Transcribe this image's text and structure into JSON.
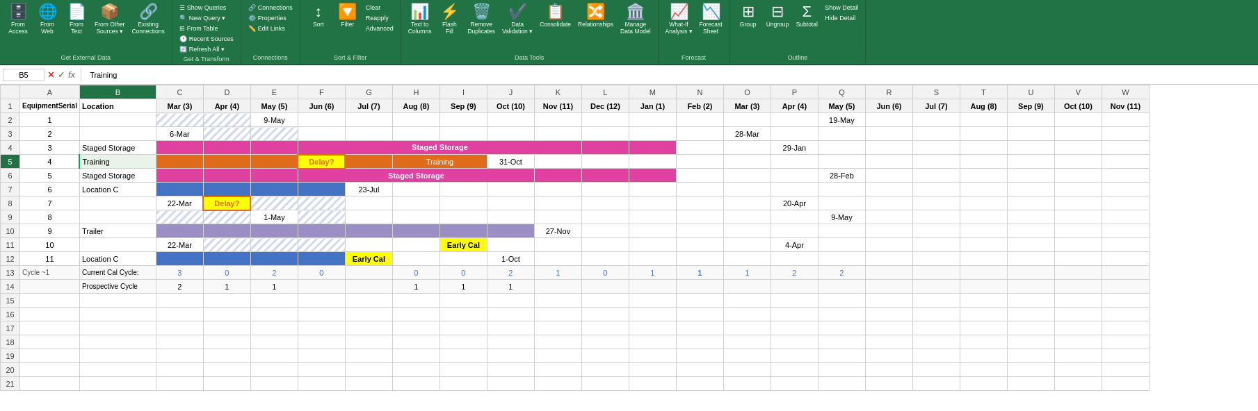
{
  "ribbon": {
    "sections": [
      {
        "name": "Get External Data",
        "label": "Get External Data",
        "buttons": [
          {
            "id": "from-access",
            "icon": "🗄️",
            "label": "From\nAccess"
          },
          {
            "id": "from-web",
            "icon": "🌐",
            "label": "From\nWeb"
          },
          {
            "id": "from-text",
            "icon": "📄",
            "label": "From\nText"
          },
          {
            "id": "from-other",
            "icon": "📦",
            "label": "From Other\nSources"
          },
          {
            "id": "existing-connections",
            "icon": "🔗",
            "label": "Existing\nConnections"
          }
        ]
      },
      {
        "name": "Get & Transform",
        "label": "Get & Transform",
        "buttons_stacked": [
          {
            "id": "show-queries",
            "label": "Show Queries"
          },
          {
            "id": "from-table",
            "label": "From Table"
          },
          {
            "id": "new-query",
            "label": "New Query ▾"
          },
          {
            "id": "recent-sources",
            "label": "Recent Sources"
          },
          {
            "id": "refresh-all",
            "label": "Refresh All ▾"
          }
        ]
      },
      {
        "name": "Connections",
        "label": "Connections",
        "buttons_stacked": [
          {
            "id": "connections",
            "label": "Connections"
          },
          {
            "id": "properties",
            "label": "Properties"
          },
          {
            "id": "edit-links",
            "label": "Edit Links"
          }
        ]
      },
      {
        "name": "Sort & Filter",
        "label": "Sort & Filter",
        "buttons": [
          {
            "id": "sort",
            "icon": "↕️",
            "label": "Sort"
          },
          {
            "id": "filter",
            "icon": "🔽",
            "label": "Filter"
          },
          {
            "id": "clear",
            "label": "Clear"
          },
          {
            "id": "reapply",
            "label": "Reapply"
          },
          {
            "id": "advanced",
            "label": "Advanced"
          }
        ]
      },
      {
        "name": "Data Tools",
        "label": "Data Tools",
        "buttons": [
          {
            "id": "text-to-columns",
            "label": "Text to\nColumns"
          },
          {
            "id": "flash-fill",
            "label": "Flash\nFill"
          },
          {
            "id": "remove-duplicates",
            "label": "Remove\nDuplicates"
          },
          {
            "id": "data-validation",
            "label": "Data\nValidation ▾"
          },
          {
            "id": "consolidate",
            "label": "Consolidate"
          },
          {
            "id": "relationships",
            "label": "Relationships"
          },
          {
            "id": "manage-data-model",
            "label": "Manage\nData Model"
          }
        ]
      },
      {
        "name": "Forecast",
        "label": "Forecast",
        "buttons": [
          {
            "id": "what-if",
            "label": "What-If\nAnalysis ▾"
          },
          {
            "id": "forecast-sheet",
            "label": "Forecast\nSheet"
          }
        ]
      },
      {
        "name": "Outline",
        "label": "Outline",
        "buttons": [
          {
            "id": "group",
            "label": "Group"
          },
          {
            "id": "ungroup",
            "label": "Ungroup"
          },
          {
            "id": "subtotal",
            "label": "Subtotal"
          },
          {
            "id": "show-detail",
            "label": "Show Detail"
          },
          {
            "id": "hide-detail",
            "label": "Hide Detail"
          }
        ]
      }
    ],
    "formula_bar": {
      "name_box": "B5",
      "formula_value": "Training"
    }
  },
  "columns": [
    "A",
    "B",
    "C",
    "D",
    "E",
    "F",
    "G",
    "H",
    "I",
    "J",
    "K",
    "L",
    "M",
    "N",
    "O",
    "P",
    "Q",
    "R",
    "S",
    "T",
    "U",
    "V",
    "W"
  ],
  "col_headers": [
    "EquipmentSerial",
    "Location",
    "Mar (3)",
    "Apr (4)",
    "May (5)",
    "Jun (6)",
    "Jul (7)",
    "Aug (8)",
    "Sep (9)",
    "Oct (10)",
    "Nov (11)",
    "Dec (12)",
    "Jan (1)",
    "Feb (2)",
    "Mar (3)",
    "Apr (4)",
    "May (5)",
    "Jun (6)",
    "Jul (7)",
    "Aug (8)",
    "Sep (9)",
    "Oct (10)",
    "Nov (11)"
  ],
  "rows": [
    {
      "num": 1,
      "cells": [
        "EquipmentSerial",
        "Location",
        "Mar (3)",
        "Apr (4)",
        "May (5)",
        "Jun (6)",
        "Jul (7)",
        "Aug (8)",
        "Sep (9)",
        "Oct (10)",
        "Nov (11)",
        "Dec (12)",
        "Jan (1)",
        "Feb (2)",
        "Mar (3)",
        "Apr (4)",
        "May (5)",
        "Jun (6)",
        "Jul (7)",
        "Aug (8)",
        "Sep (9)",
        "Oct (10)",
        "Nov (11)"
      ]
    },
    {
      "num": 2,
      "cells": [
        "1",
        "",
        "",
        "",
        "9-May",
        "",
        "",
        "",
        "",
        "",
        "",
        "",
        "",
        "",
        "",
        "",
        "19-May",
        "",
        "",
        "",
        "",
        "",
        ""
      ]
    },
    {
      "num": 3,
      "cells": [
        "2",
        "",
        "",
        "6-Mar",
        "",
        "",
        "",
        "",
        "",
        "",
        "",
        "",
        "",
        "",
        "28-Mar",
        "",
        "",
        "",
        "",
        "",
        "",
        "",
        ""
      ]
    },
    {
      "num": 4,
      "cells": [
        "3",
        "Staged Storage",
        "",
        "",
        "",
        "Staged Storage",
        "",
        "",
        "",
        "",
        "",
        "",
        "",
        "",
        "",
        "29-Jan",
        "",
        "",
        "",
        "",
        "",
        "",
        ""
      ]
    },
    {
      "num": 5,
      "cells": [
        "4",
        "Training",
        "",
        "",
        "",
        "Training",
        "",
        "",
        "",
        "31-Oct",
        "",
        "",
        "",
        "",
        "",
        "",
        "",
        "",
        "",
        "",
        "",
        "",
        ""
      ]
    },
    {
      "num": 6,
      "cells": [
        "5",
        "Staged Storage",
        "",
        "",
        "",
        "Staged Storage",
        "",
        "",
        "",
        "",
        "",
        "",
        "",
        "",
        "",
        "28-Feb",
        "",
        "",
        "",
        "",
        "",
        "",
        ""
      ]
    },
    {
      "num": 7,
      "cells": [
        "6",
        "Location C",
        "",
        "",
        "",
        "",
        "23-Jul",
        "",
        "",
        "",
        "",
        "",
        "",
        "",
        "",
        "",
        "",
        "",
        "",
        "",
        "",
        "",
        ""
      ]
    },
    {
      "num": 8,
      "cells": [
        "7",
        "",
        "22-Mar",
        "Delay?",
        "",
        "",
        "",
        "",
        "",
        "",
        "",
        "",
        "",
        "",
        "20-Apr",
        "",
        "",
        "",
        "",
        "",
        "",
        "",
        ""
      ]
    },
    {
      "num": 9,
      "cells": [
        "8",
        "",
        "",
        "",
        "1-May",
        "",
        "",
        "",
        "",
        "",
        "",
        "",
        "",
        "",
        "",
        "",
        "9-May",
        "",
        "",
        "",
        "",
        "",
        ""
      ]
    },
    {
      "num": 10,
      "cells": [
        "9",
        "Trailer",
        "",
        "",
        "",
        "",
        "",
        "",
        "",
        "",
        "27-Nov",
        "",
        "",
        "",
        "",
        "",
        "",
        "",
        "",
        "",
        "",
        "",
        ""
      ]
    },
    {
      "num": 11,
      "cells": [
        "10",
        "",
        "22-Mar",
        "",
        "",
        "",
        "",
        "",
        "Early Cal",
        "",
        "",
        "",
        "",
        "",
        "4-Apr",
        "",
        "",
        "",
        "",
        "",
        "",
        "",
        ""
      ]
    },
    {
      "num": 12,
      "cells": [
        "11",
        "Location C",
        "",
        "",
        "",
        "",
        "Early Cal",
        "",
        "",
        "1-Oct",
        "",
        "",
        "",
        "",
        "",
        "",
        "",
        "",
        "",
        "",
        "",
        "",
        ""
      ]
    },
    {
      "num": 13,
      "label": "Cycle ~1",
      "cells": [
        "",
        "Current Cal Cycle:",
        "3",
        "0",
        "2",
        "0",
        "",
        "0",
        "0",
        "2",
        "1",
        "0",
        "1",
        "1",
        "1",
        "2",
        "2",
        "",
        "",
        "",
        "",
        "",
        ""
      ]
    },
    {
      "num": 14,
      "label": "",
      "cells": [
        "",
        "Prospective Cycle",
        "2",
        "1",
        "1",
        "",
        "",
        "1",
        "1",
        "1",
        "",
        "",
        "",
        "",
        "",
        "",
        "",
        "",
        "",
        "",
        "",
        "",
        ""
      ]
    }
  ]
}
